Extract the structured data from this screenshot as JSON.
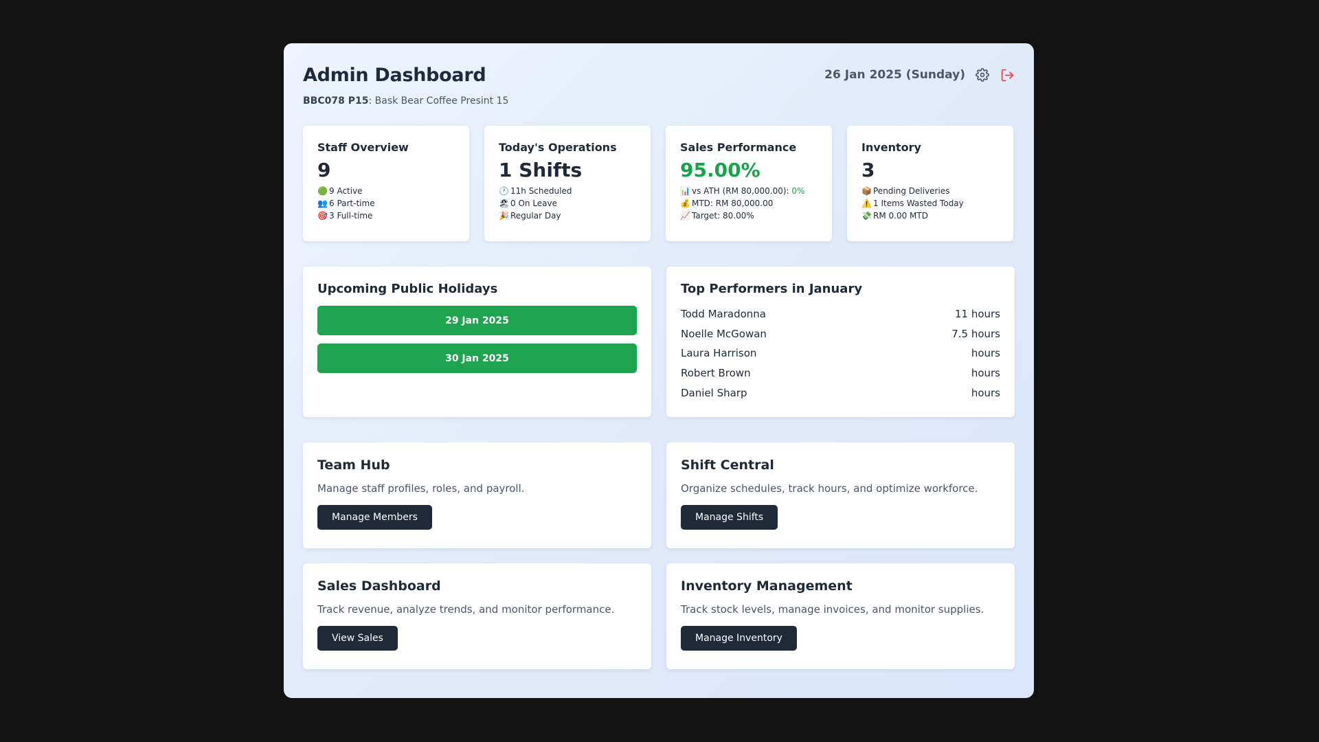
{
  "header": {
    "title": "Admin Dashboard",
    "date": "26 Jan 2025 (Sunday)",
    "settings_icon": "gear-icon",
    "logout_icon": "logout-icon",
    "logout_color": "#ef4444"
  },
  "store": {
    "code": "BBC078 P15",
    "name": ": Bask Bear Coffee Presint 15"
  },
  "stats": {
    "staff": {
      "title": "Staff Overview",
      "value": "9",
      "lines": [
        {
          "icon": "🟢",
          "text": "9 Active"
        },
        {
          "icon": "👥",
          "text": "6 Part-time"
        },
        {
          "icon": "🎯",
          "text": "3 Full-time"
        }
      ]
    },
    "operations": {
      "title": "Today's Operations",
      "value": "1 Shifts",
      "lines": [
        {
          "icon": "🕐",
          "text": "11h Scheduled"
        },
        {
          "icon": "🏖",
          "text": "0 On Leave"
        },
        {
          "icon": "🎉",
          "text": "Regular Day"
        }
      ]
    },
    "sales": {
      "title": "Sales Performance",
      "value": "95.00%",
      "value_color": "#16a34a",
      "lines": [
        {
          "icon": "📊",
          "text": "vs ATH (RM 80,000.00): ",
          "highlight": "0%"
        },
        {
          "icon": "💰",
          "text": "MTD: RM 80,000.00"
        },
        {
          "icon": "📈",
          "text": "Target: 80.00%"
        }
      ]
    },
    "inventory": {
      "title": "Inventory",
      "value": "3",
      "lines": [
        {
          "icon": "📦",
          "text": "Pending Deliveries"
        },
        {
          "icon": "⚠️",
          "text": "1 Items Wasted Today"
        },
        {
          "icon": "💸",
          "text": "RM 0.00 MTD"
        }
      ]
    }
  },
  "holidays": {
    "title": "Upcoming Public Holidays",
    "color": "#1ea34f",
    "items": [
      "29 Jan 2025",
      "30 Jan 2025"
    ]
  },
  "performers": {
    "title": "Top Performers in January",
    "rows": [
      {
        "name": "Todd Maradonna",
        "hours": "11 hours"
      },
      {
        "name": "Noelle McGowan",
        "hours": "7.5 hours"
      },
      {
        "name": "Laura Harrison",
        "hours": "hours"
      },
      {
        "name": "Robert Brown",
        "hours": "hours"
      },
      {
        "name": "Daniel Sharp",
        "hours": "hours"
      }
    ]
  },
  "modules": [
    {
      "title": "Team Hub",
      "desc": "Manage staff profiles, roles, and payroll.",
      "button": "Manage Members"
    },
    {
      "title": "Shift Central",
      "desc": "Organize schedules, track hours, and optimize workforce.",
      "button": "Manage Shifts"
    },
    {
      "title": "Sales Dashboard",
      "desc": "Track revenue, analyze trends, and monitor performance.",
      "button": "View Sales"
    },
    {
      "title": "Inventory Management",
      "desc": "Track stock levels, manage invoices, and monitor supplies.",
      "button": "Manage Inventory"
    }
  ]
}
